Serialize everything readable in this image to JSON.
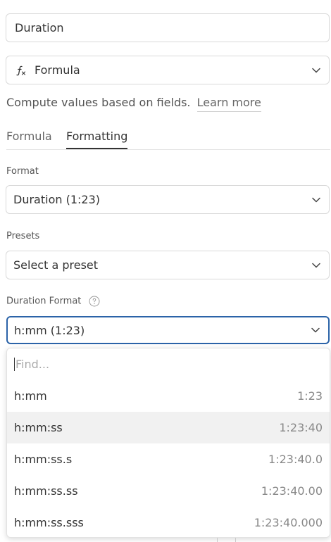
{
  "name_field": {
    "value": "Duration"
  },
  "type_select": {
    "icon": "formula-icon",
    "value": "Formula"
  },
  "description": {
    "text": "Compute values based on fields.",
    "link": "Learn more"
  },
  "tabs": [
    {
      "label": "Formula",
      "active": false
    },
    {
      "label": "Formatting",
      "active": true
    }
  ],
  "format": {
    "label": "Format",
    "value": "Duration (1:23)"
  },
  "presets": {
    "label": "Presets",
    "value": "Select a preset"
  },
  "duration_format": {
    "label": "Duration Format",
    "help_icon": "question-circle-icon",
    "value": "h:mm (1:23)"
  },
  "dropdown": {
    "search_placeholder": "Find...",
    "options": [
      {
        "label": "h:mm",
        "example": "1:23",
        "highlighted": false
      },
      {
        "label": "h:mm:ss",
        "example": "1:23:40",
        "highlighted": true
      },
      {
        "label": "h:mm:ss.s",
        "example": "1:23:40.0",
        "highlighted": false
      },
      {
        "label": "h:mm:ss.ss",
        "example": "1:23:40.00",
        "highlighted": false
      },
      {
        "label": "h:mm:ss.sss",
        "example": "1:23:40.000",
        "highlighted": false
      }
    ]
  },
  "colors": {
    "focus_border": "#2b63a8",
    "highlight_row": "#f1f1f1"
  }
}
